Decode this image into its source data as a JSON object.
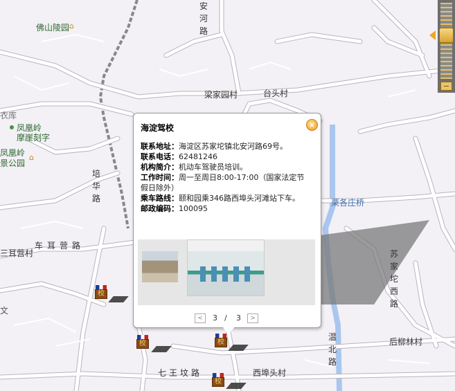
{
  "map": {
    "labels": {
      "foshan_cemetery": "佛山陵园",
      "an_he_lu": "安河路",
      "liangjiayuan": "梁家园村",
      "taitou": "台头村",
      "yi_yi_ku": "衣库",
      "fenghuangling": "凤凰岭",
      "moya": "摩崖刻字",
      "fenghuangling_park": "凤凰岭景公园",
      "pei_hua_lu": "培华路",
      "jing_ge_zhuang_bridge": "栗各庄桥",
      "sanerying": "三耳营村",
      "che_er_ying_lu": "车耳营路",
      "su_jia_tuo_xi_lu": "苏家坨西路",
      "wen_bei_lu": "温北路",
      "hou_liu_lin": "后柳林村",
      "qi_wang_fen_lu": "七王坟路",
      "xi_huang_tou": "西埠头村",
      "wen_char": "文"
    },
    "poi_icon_text": "校"
  },
  "popup": {
    "title": "海淀驾校",
    "close_icon": "×",
    "rows": [
      {
        "key": "联系地址：",
        "value": "海淀区苏家坨镇北安河路69号。"
      },
      {
        "key": "联系电话：",
        "value": "62481246"
      },
      {
        "key": "机构简介：",
        "value": "机动车驾驶员培训。"
      },
      {
        "key": "工作时间：",
        "value": "周一至周日8:00-17:00（国家法定节假日除外）"
      },
      {
        "key": "乘车路线：",
        "value": "颐和园乘346路西埠头河滩站下车。"
      },
      {
        "key": "邮政编码：",
        "value": "100095"
      }
    ],
    "pager": {
      "current": "3",
      "sep": "/",
      "total": "3",
      "prev": "<",
      "next": ">"
    }
  },
  "zoom": {
    "minus": "−"
  },
  "colors": {
    "map_bg": "#f3f0f6",
    "road": "#ffffff",
    "road_edge": "#b8b4bd",
    "river": "#a9c7ee",
    "accent": "#f0a820"
  }
}
